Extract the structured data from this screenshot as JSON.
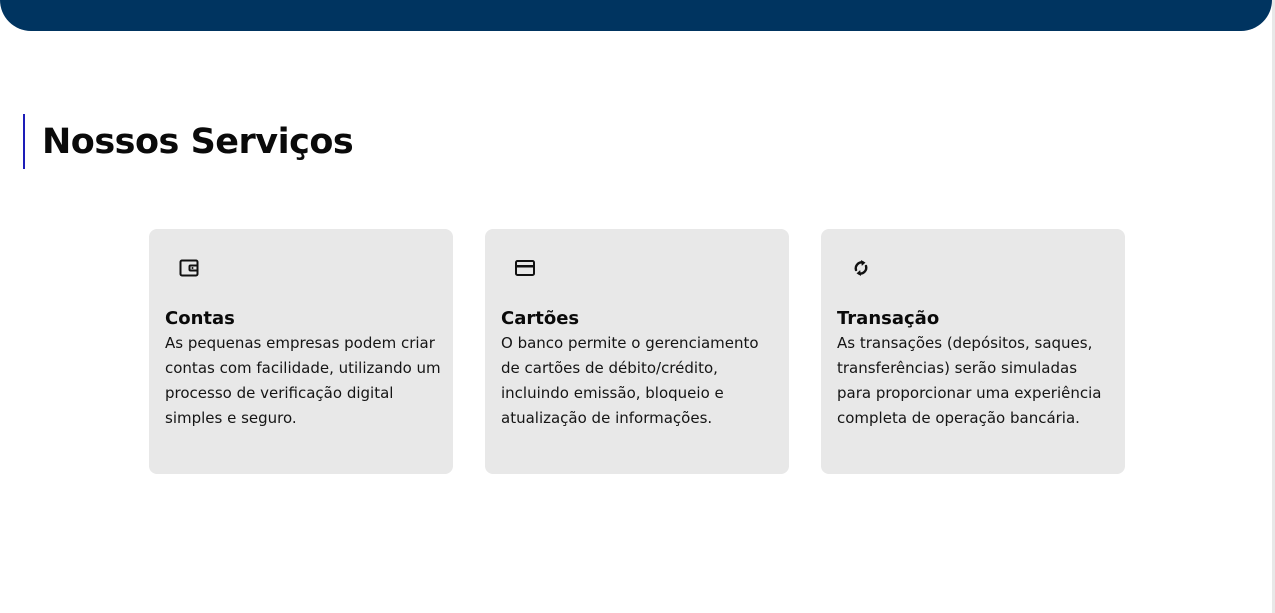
{
  "section": {
    "title": "Nossos Serviços"
  },
  "cards": [
    {
      "icon": "wallet-icon",
      "title": "Contas",
      "description": "As pequenas empresas podem criar contas com facilidade, utilizando um processo de verificação digital simples e seguro."
    },
    {
      "icon": "credit-card-icon",
      "title": "Cartões",
      "description": "O banco permite o gerenciamento de cartões de débito/crédito, incluindo emissão, bloqueio e atualização de informações."
    },
    {
      "icon": "exchange-icon",
      "title": "Transação",
      "description": "As transações (depósitos, saques, transferências) serão simuladas para proporcionar uma experiência completa de operação bancária."
    }
  ],
  "colors": {
    "banner": "#003460",
    "title_accent": "#1d1db8",
    "card_background": "#e8e8e8"
  }
}
